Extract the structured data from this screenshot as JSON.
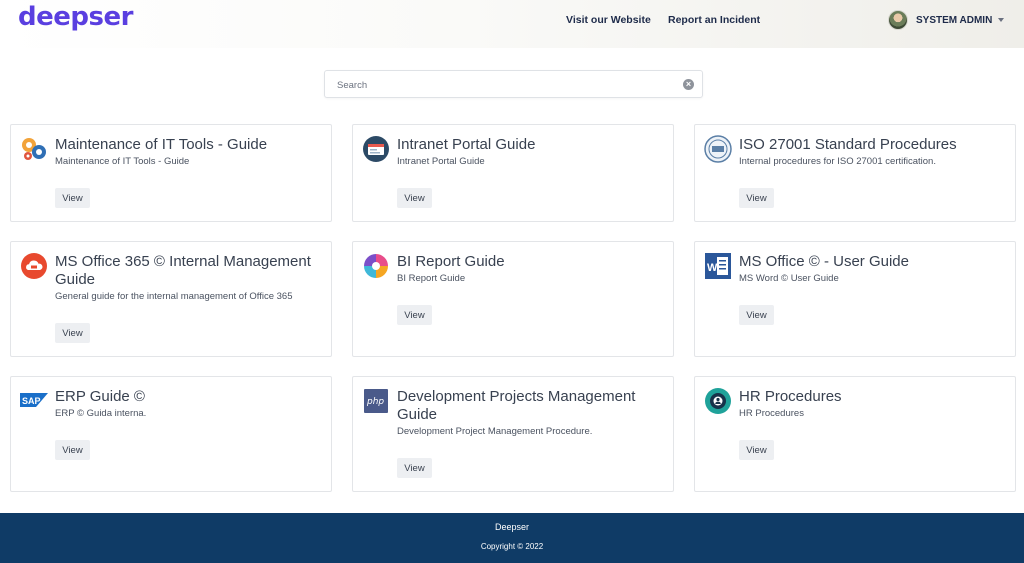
{
  "header": {
    "logo": "deepser",
    "nav": {
      "visit_website": "Visit our Website",
      "report_incident": "Report an Incident"
    },
    "user": {
      "name": "SYSTEM ADMIN"
    }
  },
  "search": {
    "placeholder": "Search",
    "value": ""
  },
  "cards": [
    {
      "title": "Maintenance of IT Tools - Guide",
      "description": "Maintenance of IT Tools - Guide",
      "button": "View",
      "icon": "gears-icon"
    },
    {
      "title": "Intranet Portal Guide",
      "description": "Intranet Portal Guide",
      "button": "View",
      "icon": "browser-window-icon"
    },
    {
      "title": "ISO 27001 Standard Procedures",
      "description": "Internal procedures for ISO 27001 certification.",
      "button": "View",
      "icon": "iso-seal-icon"
    },
    {
      "title": "MS Office 365 © Internal Management Guide",
      "description": "General guide for the internal management of Office 365",
      "button": "View",
      "icon": "office365-cloud-icon"
    },
    {
      "title": "BI Report Guide",
      "description": "BI Report Guide",
      "button": "View",
      "icon": "bi-pinwheel-icon"
    },
    {
      "title": "MS Office © - User Guide",
      "description": "MS Word © User Guide",
      "button": "View",
      "icon": "ms-word-icon"
    },
    {
      "title": "ERP Guide ©",
      "description": "ERP © Guida interna.",
      "button": "View",
      "icon": "sap-logo-icon"
    },
    {
      "title": "Development Projects Management Guide",
      "description": "Development Project Management Procedure.",
      "button": "View",
      "icon": "php-icon"
    },
    {
      "title": "HR Procedures",
      "description": "HR Procedures",
      "button": "View",
      "icon": "hr-gear-icon"
    }
  ],
  "footer": {
    "brand": "Deepser",
    "copyright": "Copyright © 2022"
  },
  "colors": {
    "logo": "#5a3fe0",
    "nav_text": "#1e2b4a",
    "footer_bg": "#0f3b66",
    "button_bg": "#edeff2"
  }
}
